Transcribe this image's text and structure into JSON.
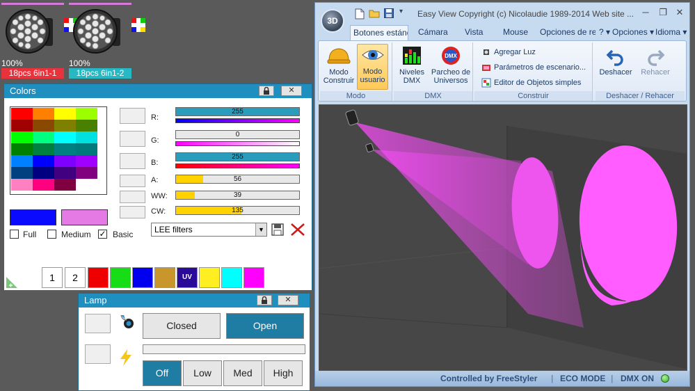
{
  "fixtures": [
    {
      "percent": "100%",
      "label": "18pcs 6in1-1",
      "label_color": "#e8323c"
    },
    {
      "percent": "100%",
      "label": "18pcs 6in1-2",
      "label_color": "#27b8c4"
    }
  ],
  "colors_panel": {
    "title": "Colors",
    "channels": [
      {
        "label": "R:",
        "value": "255",
        "level": 1.0
      },
      {
        "label": "G:",
        "value": "0",
        "level": 0.0
      },
      {
        "label": "B:",
        "value": "255",
        "level": 1.0
      },
      {
        "label": "A:",
        "value": "56",
        "level": 0.22
      },
      {
        "label": "WW:",
        "value": "39",
        "level": 0.15
      },
      {
        "label": "CW:",
        "value": "135",
        "level": 0.53
      }
    ],
    "filter_select": "LEE filters",
    "checkboxes": [
      {
        "label": "Full",
        "checked": false
      },
      {
        "label": "Medium",
        "checked": false
      },
      {
        "label": "Basic",
        "checked": true
      }
    ],
    "quick_numbers": [
      "1",
      "2"
    ],
    "uv_label": "UV",
    "current_color": "#0a0aff",
    "preview_color": "#e57ae5"
  },
  "lamp_panel": {
    "title": "Lamp",
    "closed_label": "Closed",
    "open_label": "Open",
    "levels": [
      "Off",
      "Low",
      "Med",
      "High"
    ]
  },
  "window": {
    "logo": "3D",
    "title": "Easy View   Copyright (c) Nicolaudie 1989-2014   Web site ...",
    "tabs": [
      "Botones estánd",
      "Cámara",
      "Vista",
      "Mouse",
      "Opciones de re",
      "? ▾",
      "Opciones ▾",
      "Idioma ▾"
    ],
    "groups": {
      "modo": {
        "label": "Modo",
        "construir": "Modo Construir",
        "usuario": "Modo usuario"
      },
      "dmx": {
        "label": "DMX",
        "niveles": "Niveles DMX",
        "parcheo": "Parcheo de Universos"
      },
      "construir": {
        "label": "Construir",
        "items": [
          "Agregar Luz",
          "Parámetros de escenario...",
          "Editor de Objetos simples"
        ]
      },
      "deshacer": {
        "label": "Deshacer / Rehacer",
        "undo": "Deshacer",
        "redo": "Rehacer"
      }
    },
    "status": {
      "controlled": "Controlled by FreeStyler",
      "eco": "ECO MODE",
      "dmx": "DMX ON"
    }
  }
}
